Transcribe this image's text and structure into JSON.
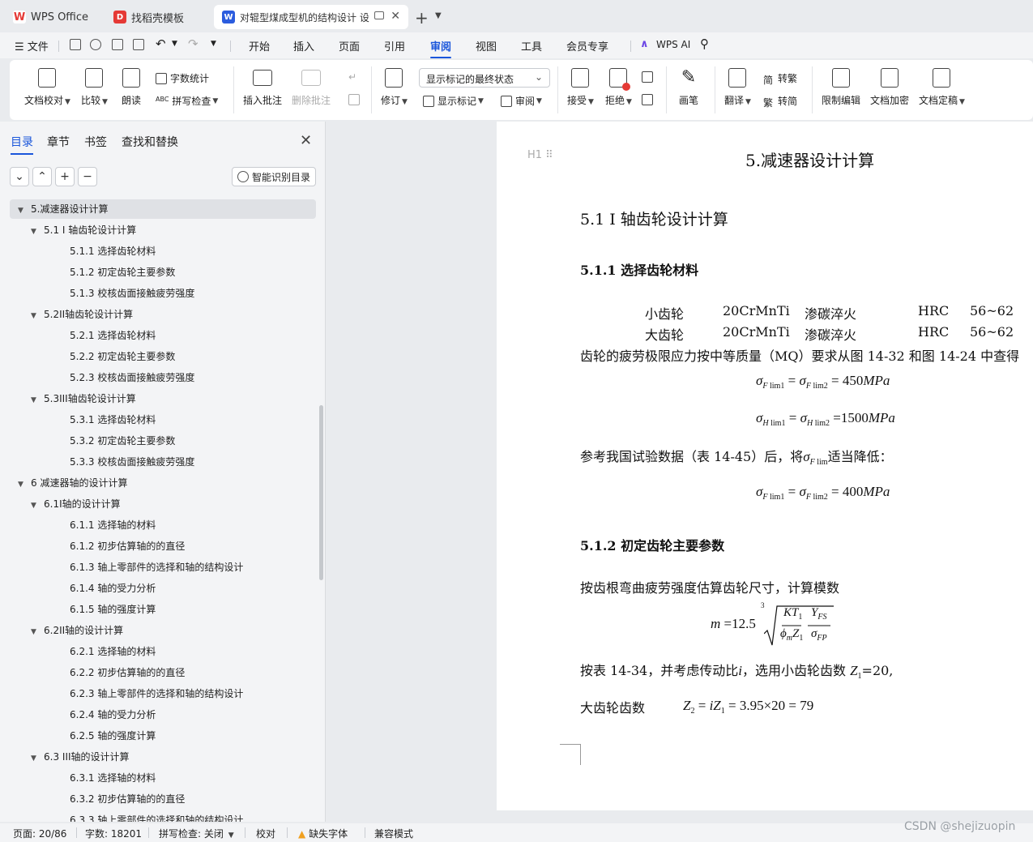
{
  "tabs": [
    {
      "label": "WPS Office",
      "icon": "wps-logo-icon",
      "color": "#e53935"
    },
    {
      "label": "找稻壳模板",
      "icon": "docer-icon",
      "color": "#e53935"
    },
    {
      "label": "对辊型煤成型机的结构设计 设",
      "icon": "word-doc-icon",
      "color": "#2b5cde",
      "active": true
    }
  ],
  "menubar": {
    "file_label": "文件",
    "items": [
      "开始",
      "插入",
      "页面",
      "引用",
      "审阅",
      "视图",
      "工具",
      "会员专享"
    ],
    "active": "审阅",
    "ai_label": "WPS AI"
  },
  "ribbon": {
    "doc_check": "文档校对",
    "compare": "比较",
    "read_aloud": "朗读",
    "word_count": "字数统计",
    "spell_check": "拼写检查",
    "insert_comment": "插入批注",
    "delete_comment": "删除批注",
    "revise": "修订",
    "markup_state": "显示标记的最终状态",
    "show_markup": "显示标记",
    "review": "审阅",
    "accept": "接受",
    "reject": "拒绝",
    "pen": "画笔",
    "translate": "翻译",
    "to_traditional": "转繁",
    "to_simplified": "转简",
    "restrict_edit": "限制编辑",
    "encrypt": "文档加密",
    "finalize": "文档定稿"
  },
  "nav": {
    "tabs": [
      "目录",
      "章节",
      "书签",
      "查找和替换"
    ],
    "active_tab": "目录",
    "smart_toc": "智能识别目录",
    "toc": [
      {
        "text": "5.减速器设计计算",
        "level": 1,
        "toggle": "▼",
        "selected": true
      },
      {
        "text": "5.1 I 轴齿轮设计计算",
        "level": 2,
        "toggle": "▼"
      },
      {
        "text": "5.1.1 选择齿轮材料",
        "level": 3
      },
      {
        "text": "5.1.2 初定齿轮主要参数",
        "level": 3
      },
      {
        "text": "5.1.3 校核齿面接触疲劳强度",
        "level": 3
      },
      {
        "text": "5.2II轴齿轮设计计算",
        "level": 2,
        "toggle": "▼"
      },
      {
        "text": "5.2.1 选择齿轮材料",
        "level": 3
      },
      {
        "text": "5.2.2  初定齿轮主要参数",
        "level": 3
      },
      {
        "text": "5.2.3 校核齿面接触疲劳强度",
        "level": 3
      },
      {
        "text": "5.3III轴齿轮设计计算",
        "level": 2,
        "toggle": "▼"
      },
      {
        "text": "5.3.1 选择齿轮材料",
        "level": 3
      },
      {
        "text": "5.3.2  初定齿轮主要参数",
        "level": 3
      },
      {
        "text": "5.3.3  校核齿面接触疲劳强度",
        "level": 3
      },
      {
        "text": "6  减速器轴的设计计算",
        "level": 1,
        "toggle": "▼"
      },
      {
        "text": "6.1I轴的设计计算",
        "level": 2,
        "toggle": "▼"
      },
      {
        "text": "6.1.1 选择轴的材料",
        "level": 3
      },
      {
        "text": "6.1.2 初步估算轴的的直径",
        "level": 3
      },
      {
        "text": "6.1.3 轴上零部件的选择和轴的结构设计",
        "level": 3
      },
      {
        "text": "6.1.4 轴的受力分析",
        "level": 3
      },
      {
        "text": "6.1.5 轴的强度计算",
        "level": 3
      },
      {
        "text": "6.2II轴的设计计算",
        "level": 2,
        "toggle": "▼"
      },
      {
        "text": "6.2.1 选择轴的材料",
        "level": 3
      },
      {
        "text": "6.2.2 初步估算轴的的直径",
        "level": 3
      },
      {
        "text": "6.2.3 轴上零部件的选择和轴的结构设计",
        "level": 3
      },
      {
        "text": "6.2.4 轴的受力分析",
        "level": 3
      },
      {
        "text": "6.2.5 轴的强度计算",
        "level": 3
      },
      {
        "text": "6.3 III轴的设计计算",
        "level": 2,
        "toggle": "▼"
      },
      {
        "text": "6.3.1 选择轴的材料",
        "level": 3
      },
      {
        "text": "6.3.2 初步估算轴的的直径",
        "level": 3
      },
      {
        "text": "6.3.3 轴上零部件的选择和轴的结构设计",
        "level": 3
      }
    ]
  },
  "doc": {
    "heading_marker": "H1",
    "title": "5.减速器设计计算",
    "h2": "5.1 I 轴齿轮设计计算",
    "h3_1": "5.1.1 选择齿轮材料",
    "mat_small": {
      "name": "小齿轮",
      "steel": "20CrMnTi",
      "treat": "渗碳淬火",
      "hrc": "HRC",
      "range": "56~62"
    },
    "mat_big": {
      "name": "大齿轮",
      "steel": "20CrMnTi",
      "treat": "渗碳淬火",
      "hrc": "HRC",
      "range": "56~62"
    },
    "para1": "齿轮的疲劳极限应力按中等质量（MQ）要求从图 14-32 和图 14-24 中查得",
    "para2_a": "参考我国试验数据（表 14-45）后，将",
    "para2_b": "适当降低：",
    "h3_2": "5.1.2 初定齿轮主要参数",
    "para3": "按齿根弯曲疲劳强度估算齿轮尺寸，计算模数",
    "para4_a": "按表 14-34，并考虑传动比",
    "para4_b": "，选用小齿轮齿数",
    "para4_c": "=20,",
    "para5": "大齿轮齿数"
  },
  "status": {
    "page": "页面: 20/86",
    "words": "字数: 18201",
    "spell": "拼写检查: 关闭",
    "proof": "校对",
    "missing_font": "缺失字体",
    "compat": "兼容模式"
  },
  "watermark": "CSDN @shejizuopin"
}
